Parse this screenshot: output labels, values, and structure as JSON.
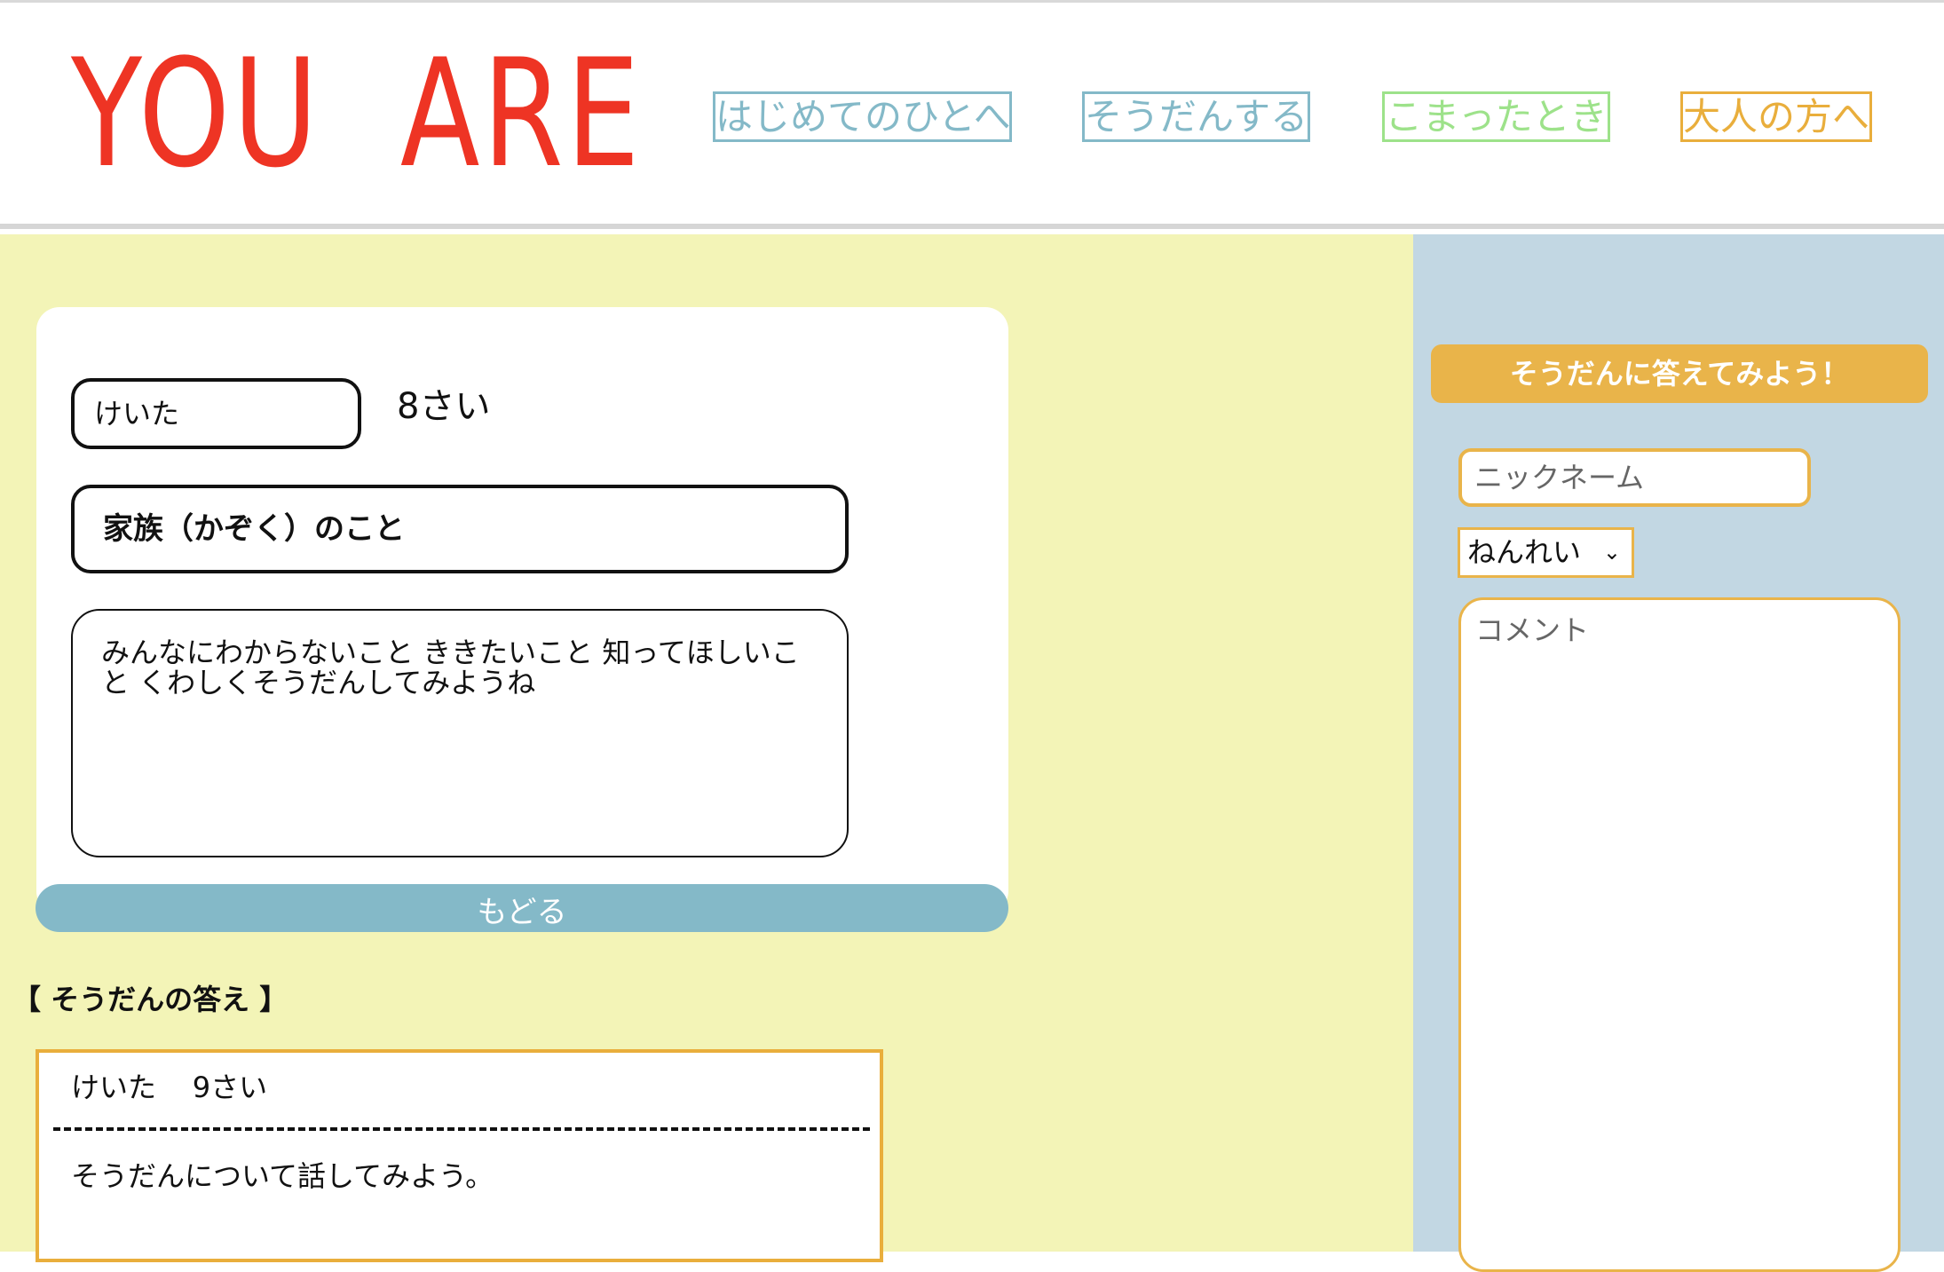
{
  "header": {
    "logo_text": "YOU  ARE",
    "nav": [
      {
        "label": "はじめてのひとへ",
        "color": "#84b9c8"
      },
      {
        "label": "そうだんする",
        "color": "#84b9c8"
      },
      {
        "label": "こまったとき",
        "color": "#9de28a"
      },
      {
        "label": "大人の方へ",
        "color": "#e9ae3c"
      }
    ]
  },
  "consultation": {
    "name": "けいた",
    "age": "8さい",
    "topic": "家族（かぞく）のこと",
    "body": "みんなにわからないこと ききたいこと 知ってほしいこと くわしくそうだんしてみようね",
    "back_label": "もどる"
  },
  "answers": {
    "heading": "【 そうだんの答え 】",
    "items": [
      {
        "name": "けいた",
        "age": "9さい",
        "body": "そうだんについて話してみよう。"
      }
    ]
  },
  "reply_form": {
    "title": "そうだんに答えてみよう！",
    "nickname_placeholder": "ニックネーム",
    "age_selected": "ねんれい",
    "comment_placeholder": "コメント"
  },
  "colors": {
    "brand_red": "#ee3424",
    "accent_blue": "#84b9c8",
    "accent_green": "#9de28a",
    "accent_orange": "#e9ae3c",
    "left_background": "#f3f4b7",
    "right_background": "#c2d7e3"
  }
}
